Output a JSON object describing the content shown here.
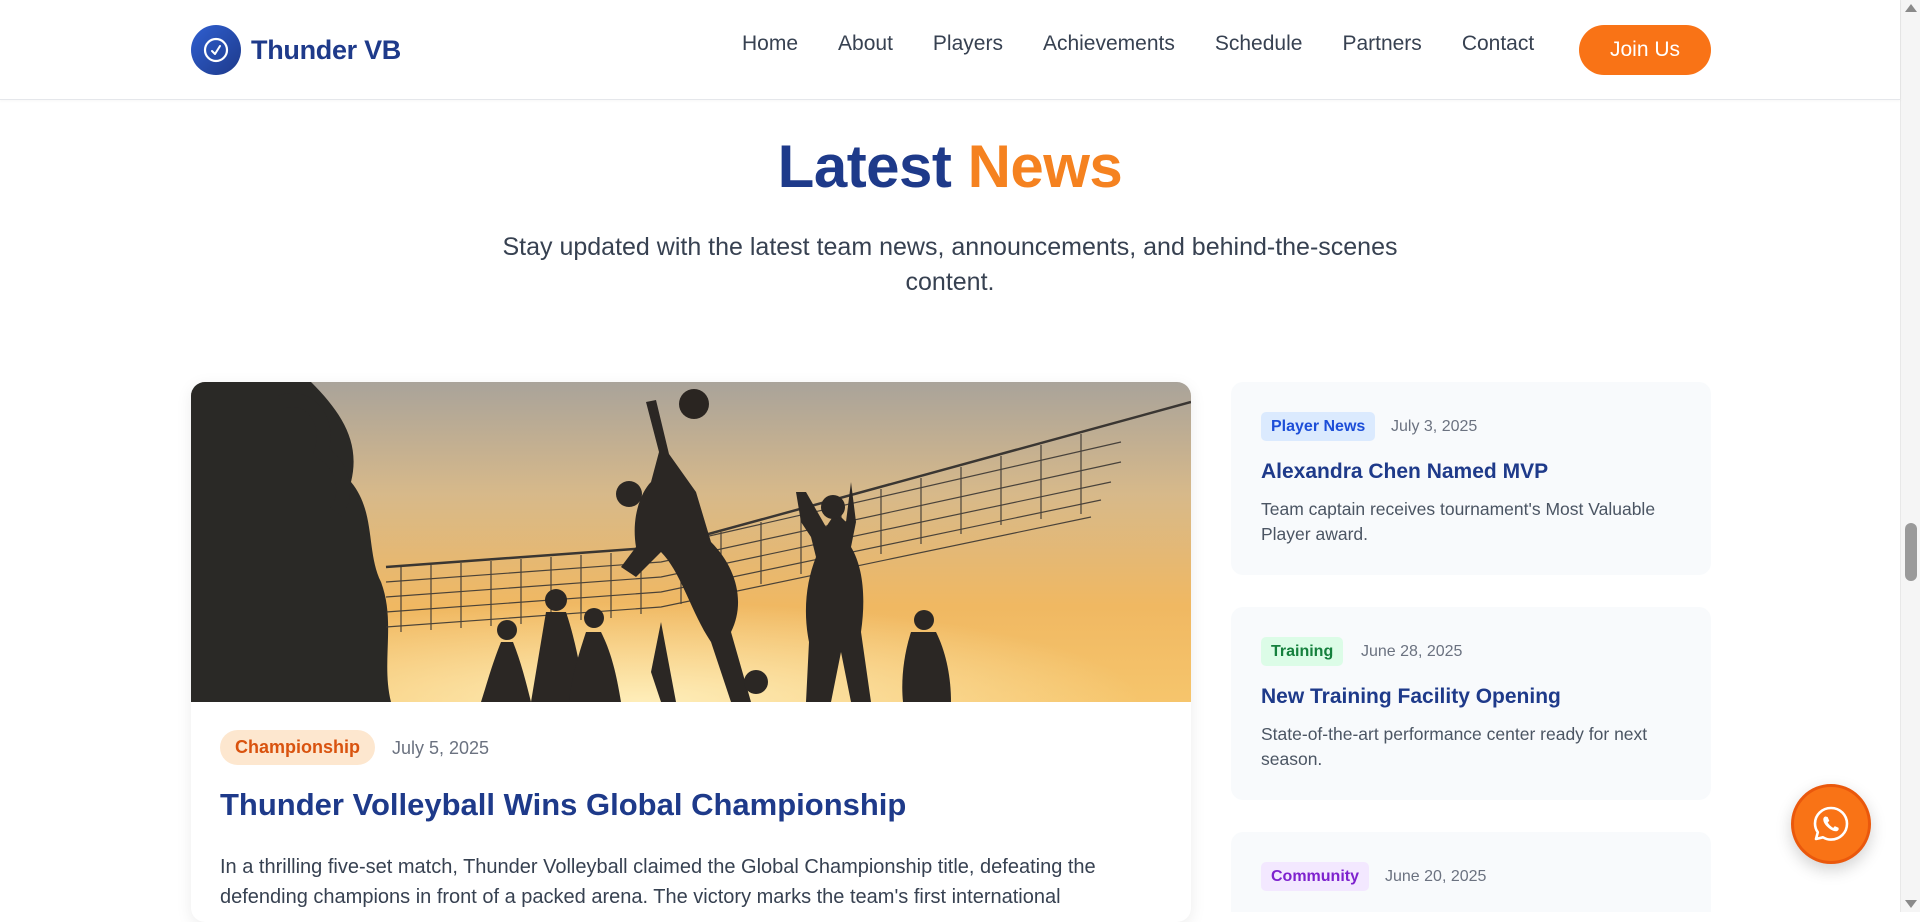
{
  "brand": {
    "name": "Thunder VB",
    "logo_icon": "volleyball-icon",
    "primary_color": "#1e3a8a",
    "accent_color": "#f97316"
  },
  "nav": {
    "items": [
      {
        "label": "Home"
      },
      {
        "label": "About"
      },
      {
        "label": "Players"
      },
      {
        "label": "Achievements"
      },
      {
        "label": "Schedule"
      },
      {
        "label": "Partners"
      },
      {
        "label": "Contact"
      }
    ],
    "cta_label": "Join Us"
  },
  "section": {
    "title_part1": "Latest",
    "title_part2": "News",
    "subtitle": "Stay updated with the latest team news, announcements, and behind-the-scenes content."
  },
  "featured": {
    "image_icon": "volleyball-sunset-photo",
    "tag": "Championship",
    "date": "July 5, 2025",
    "title": "Thunder Volleyball Wins Global Championship",
    "body": "In a thrilling five-set match, Thunder Volleyball claimed the Global Championship title, defeating the defending champions in front of a packed arena. The victory marks the team's first international"
  },
  "side_news": [
    {
      "tag": "Player News",
      "tag_color": "#1d4ed8",
      "tag_bg": "#dbeafe",
      "date": "July 3, 2025",
      "title": "Alexandra Chen Named MVP",
      "body": "Team captain receives tournament's Most Valuable Player award."
    },
    {
      "tag": "Training",
      "tag_color": "#15803d",
      "tag_bg": "#dcfce7",
      "date": "June 28, 2025",
      "title": "New Training Facility Opening",
      "body": "State-of-the-art performance center ready for next season."
    },
    {
      "tag": "Community",
      "tag_color": "#7e22ce",
      "tag_bg": "#f3e8ff",
      "date": "June 20, 2025",
      "title": "",
      "body": ""
    }
  ],
  "floating": {
    "icon": "whatsapp-icon"
  }
}
